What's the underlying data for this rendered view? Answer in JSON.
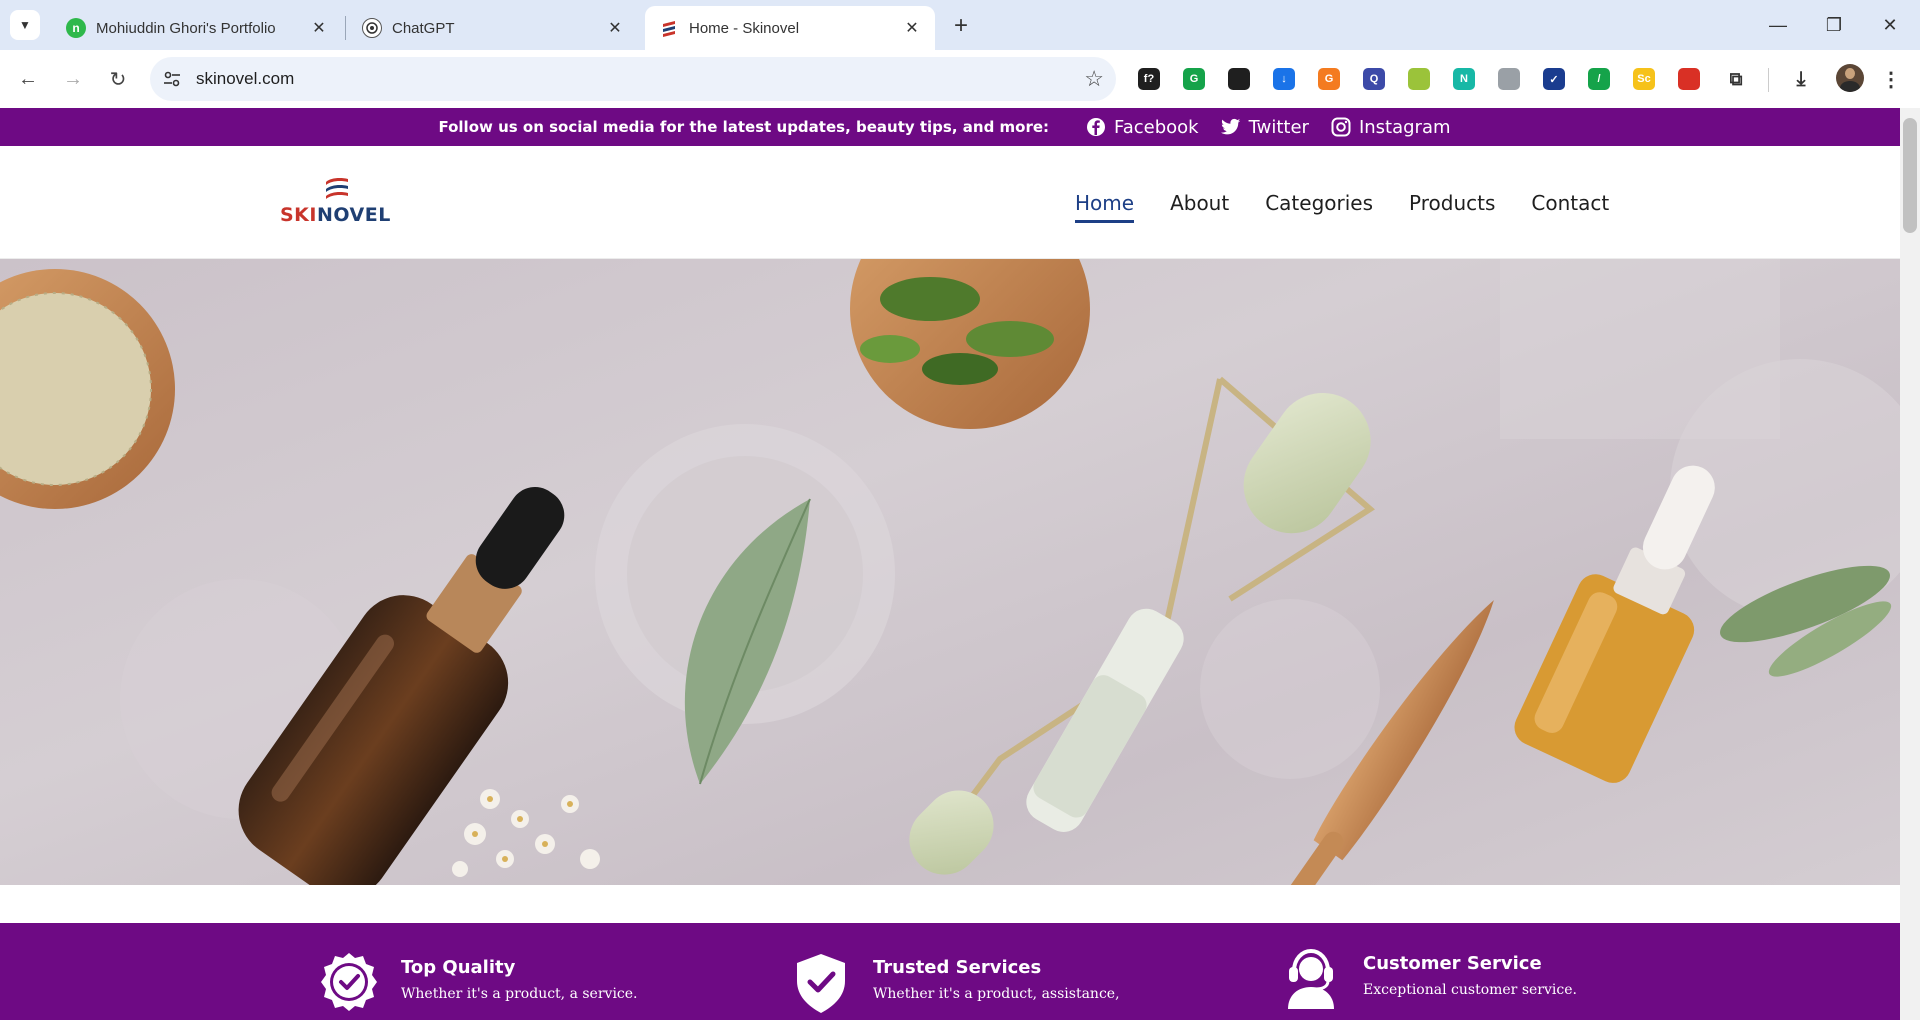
{
  "browser": {
    "tabs": [
      {
        "title": "Mohiuddin Ghori's Portfolio",
        "favicon": "portfolio-favicon"
      },
      {
        "title": "ChatGPT",
        "favicon": "chatgpt-favicon"
      },
      {
        "title": "Home - Skinovel",
        "favicon": "skinovel-favicon",
        "active": true
      }
    ],
    "url": "skinovel.com",
    "extensions": [
      {
        "name": "script-extension-icon",
        "label": "f?",
        "color": "#1f1f1f"
      },
      {
        "name": "grammarly-extension-icon",
        "label": "G",
        "color": "#15a34a"
      },
      {
        "name": "eyedropper-extension-icon",
        "label": "",
        "color": "#1f1f1f"
      },
      {
        "name": "download-extension-icon",
        "label": "↓",
        "color": "#1a73e8"
      },
      {
        "name": "g-extension-icon",
        "label": "G",
        "color": "#f47b20"
      },
      {
        "name": "search-extension-icon",
        "label": "Q",
        "color": "#3c4aa8"
      },
      {
        "name": "bulb-extension-icon",
        "label": "",
        "color": "#9bc33a"
      },
      {
        "name": "notion-extension-icon",
        "label": "N",
        "color": "#17b8a6"
      },
      {
        "name": "image-extension-icon",
        "label": "",
        "color": "#9aa0a6"
      },
      {
        "name": "check-extension-icon",
        "label": "✓",
        "color": "#1a3c8f"
      },
      {
        "name": "pen-extension-icon",
        "label": "/",
        "color": "#15a34a"
      },
      {
        "name": "sc-extension-icon",
        "label": "Sc",
        "color": "#f6c21a"
      },
      {
        "name": "pokeball-extension-icon",
        "label": "",
        "color": "#d93025"
      }
    ]
  },
  "site": {
    "social_bar": {
      "message": "Follow us on social media for the latest updates, beauty tips, and more:",
      "links": [
        "Facebook",
        "Twitter",
        "Instagram"
      ]
    },
    "logo": {
      "part1": "SKI",
      "part2": "NOVEL"
    },
    "nav": [
      "Home",
      "About",
      "Categories",
      "Products",
      "Contact"
    ],
    "features": [
      {
        "title": "Top Quality",
        "desc": "Whether it's a product, a service."
      },
      {
        "title": "Trusted Services",
        "desc": "Whether it's a product, assistance,"
      },
      {
        "title": "Customer Service",
        "desc": "Exceptional customer service."
      }
    ]
  },
  "colors": {
    "brand_purple": "#6e0a84",
    "nav_active": "#1d3f86"
  }
}
